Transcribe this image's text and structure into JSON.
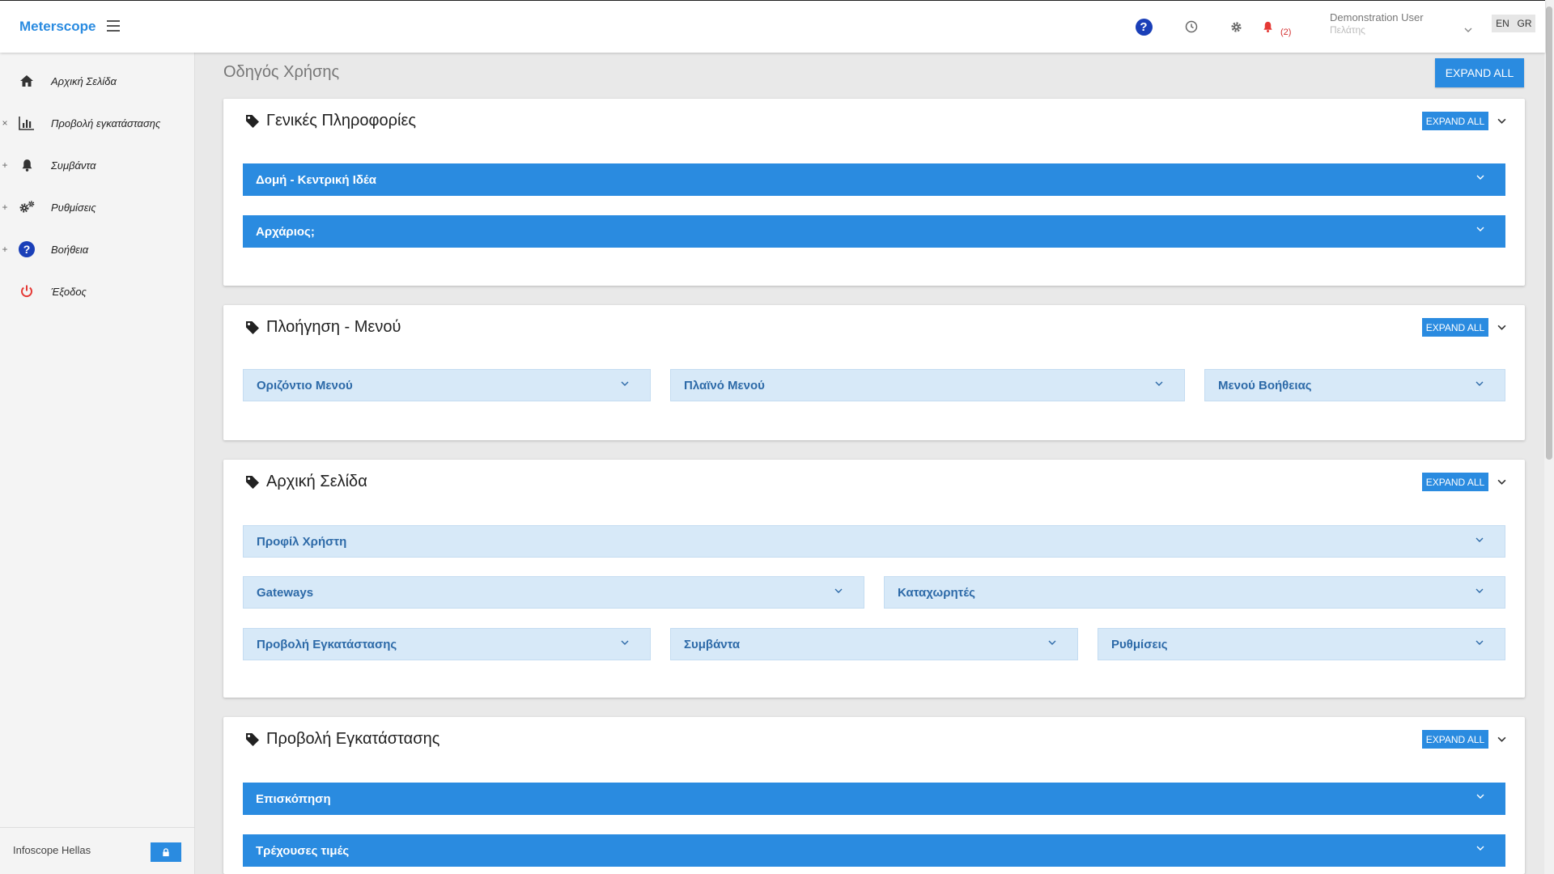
{
  "header": {
    "brand": "Meterscope",
    "notification_count": "(2)",
    "user_name": "Demonstration User",
    "user_role": "Πελάτης",
    "lang_en": "EN",
    "lang_gr": "GR",
    "icons": [
      "help-icon",
      "clock-icon",
      "gear-icon",
      "bell-icon",
      "chevron-down-icon"
    ]
  },
  "sidebar": {
    "items": [
      {
        "label": "Αρχική Σελίδα",
        "marker": "",
        "icon": "home-icon"
      },
      {
        "label": "Προβολή εγκατάστασης",
        "marker": "×",
        "icon": "bar-chart-icon"
      },
      {
        "label": "Συμβάντα",
        "marker": "+",
        "icon": "bell-icon"
      },
      {
        "label": "Ρυθμίσεις",
        "marker": "+",
        "icon": "gears-icon"
      },
      {
        "label": "Βοήθεια",
        "marker": "+",
        "icon": "help-icon"
      },
      {
        "label": "Έξοδος",
        "marker": "",
        "icon": "power-icon"
      }
    ],
    "footer": "Infoscope Hellas"
  },
  "main": {
    "title": "Οδηγός Χρήσης",
    "expand_all": "EXPAND ALL",
    "cards": [
      {
        "title": "Γενικές Πληροφορίες",
        "expand": "EXPAND ALL",
        "panels": [
          "Δομή - Κεντρική Ιδέα",
          "Αρχάριος;"
        ]
      },
      {
        "title": "Πλοήγηση - Μενού",
        "expand": "EXPAND ALL",
        "panels": [
          "Οριζόντιο Μενού",
          "Πλαϊνό Μενού",
          "Μενού Βοήθειας"
        ]
      },
      {
        "title": "Αρχική Σελίδα",
        "expand": "EXPAND ALL",
        "panels": [
          "Προφίλ Χρήστη",
          "Gateways",
          "Καταχωρητές",
          "Προβολή Εγκατάστασης",
          "Συμβάντα",
          "Ρυθμίσεις"
        ]
      },
      {
        "title": "Προβολή Εγκατάστασης",
        "expand": "EXPAND ALL",
        "panels": [
          "Επισκόπηση",
          "Τρέχουσες τιμές"
        ]
      }
    ]
  },
  "colors": {
    "accent": "#2a8be0",
    "panel_light": "#d7e9f8",
    "panel_light_text": "#2d6aa8",
    "help_blue": "#1a3fb8",
    "alert_red": "#d32f2f"
  }
}
